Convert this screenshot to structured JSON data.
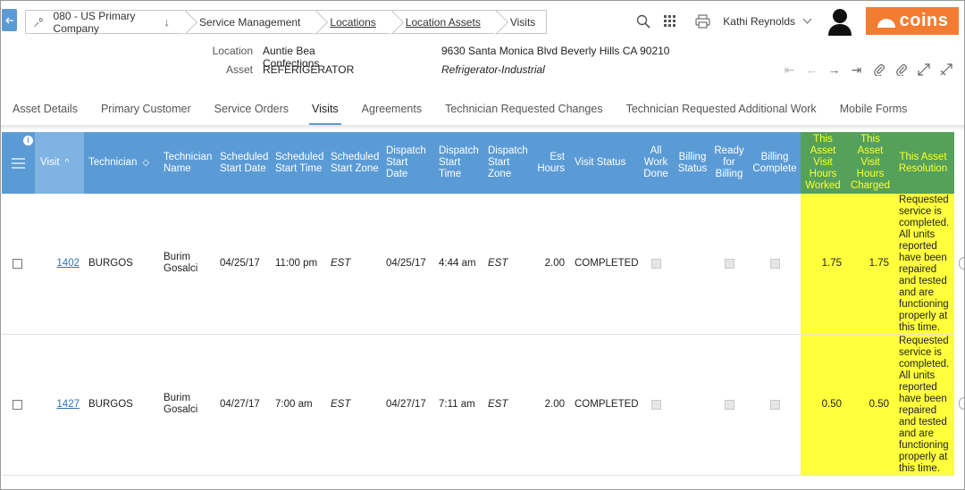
{
  "breadcrumb": {
    "company": "080 - US Primary Company",
    "items": [
      "Service Management",
      "Locations",
      "Location Assets",
      "Visits"
    ]
  },
  "user": {
    "name": "Kathi Reynolds"
  },
  "logo": {
    "text": "coins"
  },
  "info": {
    "location_label": "Location",
    "location_value": "Auntie Bea Confections",
    "asset_label": "Asset",
    "asset_value": "REFERIGERATOR",
    "address": "9630 Santa Monica Blvd Beverly Hills CA 90210",
    "asset_type": "Refrigerator-Industrial"
  },
  "tabs": [
    "Asset Details",
    "Primary Customer",
    "Service Orders",
    "Visits",
    "Agreements",
    "Technician Requested Changes",
    "Technician Requested Additional Work",
    "Mobile Forms"
  ],
  "active_tab": "Visits",
  "columns": {
    "visit": "Visit",
    "technician": "Technician",
    "technician_name": "Technician Name",
    "sched_start_date": "Scheduled Start Date",
    "sched_start_time": "Scheduled Start Time",
    "sched_start_zone": "Scheduled Start Zone",
    "dispatch_start_date": "Dispatch Start Date",
    "dispatch_start_time": "Dispatch Start Time",
    "dispatch_start_zone": "Dispatch Start Zone",
    "est_hours": "Est Hours",
    "visit_status": "Visit Status",
    "all_work_done": "All Work Done",
    "billing_status": "Billing Status",
    "ready_for_billing": "Ready for Billing",
    "billing_complete": "Billing Complete",
    "hours_worked": "This Asset Visit Hours Worked",
    "hours_charged": "This Asset Visit Hours Charged",
    "resolution": "This Asset Resolution"
  },
  "rows": [
    {
      "visit": "1402",
      "technician": "BURGOS",
      "tech_first": "Burim",
      "tech_last": "Gosalci",
      "sched_date": "04/25/17",
      "sched_time": "11:00 pm",
      "sched_zone": "EST",
      "disp_date": "04/25/17",
      "disp_time": "4:44 am",
      "disp_zone": "EST",
      "est_hours": "2.00",
      "status": "COMPLETED",
      "hours_worked": "1.75",
      "hours_charged": "1.75",
      "resolution": [
        "Requested",
        "service is",
        "completed.",
        "All units",
        "reported",
        "have been",
        "repaired",
        "and tested",
        "and are",
        "functioning",
        "properly at",
        "this time."
      ]
    },
    {
      "visit": "1427",
      "technician": "BURGOS",
      "tech_first": "Burim",
      "tech_last": "Gosalci",
      "sched_date": "04/27/17",
      "sched_time": "7:00 am",
      "sched_zone": "EST",
      "disp_date": "04/27/17",
      "disp_time": "7:11 am",
      "disp_zone": "EST",
      "est_hours": "2.00",
      "status": "COMPLETED",
      "hours_worked": "0.50",
      "hours_charged": "0.50",
      "resolution": [
        "Requested",
        "service is",
        "completed.",
        "All units",
        "reported",
        "have been",
        "repaired",
        "and tested",
        "and are",
        "functioning",
        "properly at",
        "this time."
      ]
    }
  ],
  "colors": {
    "header_blue": "#5b9bd5",
    "highlight_yellow": "#ffff3c",
    "highlight_green": "#55a05a",
    "brand_orange": "#f47c30"
  }
}
